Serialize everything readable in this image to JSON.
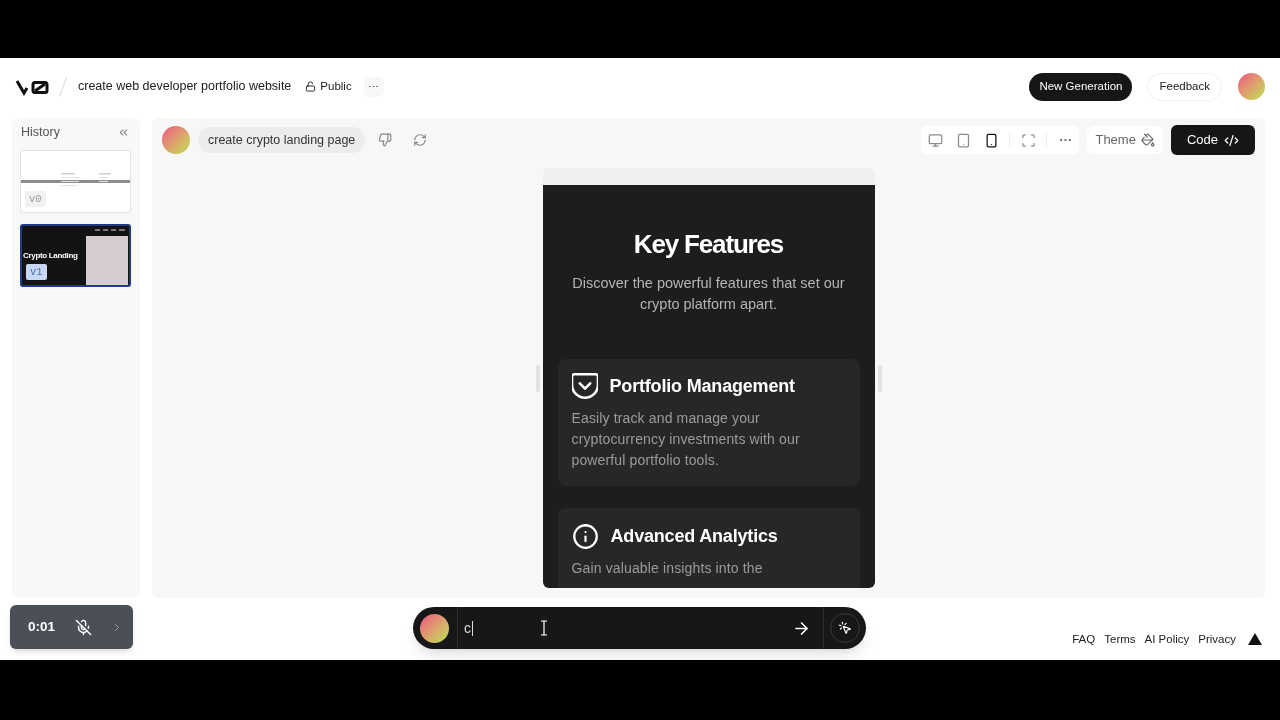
{
  "header": {
    "title": "create web developer portfolio website",
    "visibility": "Public",
    "primary_action": "New Generation",
    "secondary_action": "Feedback"
  },
  "history": {
    "title": "History",
    "items": [
      {
        "version": "v0",
        "kind": "light",
        "selected": false
      },
      {
        "version": "v1",
        "kind": "dark",
        "selected": true,
        "heading": "Crypto Landing"
      }
    ]
  },
  "toolbar": {
    "prompt": "create crypto landing page",
    "view_modes": [
      {
        "kind": "desktop",
        "selected": false
      },
      {
        "kind": "tablet",
        "selected": false
      },
      {
        "kind": "mobile",
        "selected": true
      }
    ],
    "theme": "Theme",
    "code": "Code"
  },
  "preview": {
    "heading": "Key Features",
    "subtitle": "Discover the powerful features that set our crypto platform apart.",
    "features": [
      {
        "kind": "pocket",
        "title": "Portfolio Management",
        "description": "Easily track and manage your cryptocurrency investments with our powerful portfolio tools."
      },
      {
        "kind": "info",
        "title": "Advanced Analytics",
        "description": "Gain valuable insights into the"
      }
    ]
  },
  "recorder": {
    "time": "0:01",
    "muted": true
  },
  "composer": {
    "value": "c"
  },
  "footer": {
    "links": [
      "FAQ",
      "Terms",
      "AI Policy",
      "Privacy"
    ]
  }
}
